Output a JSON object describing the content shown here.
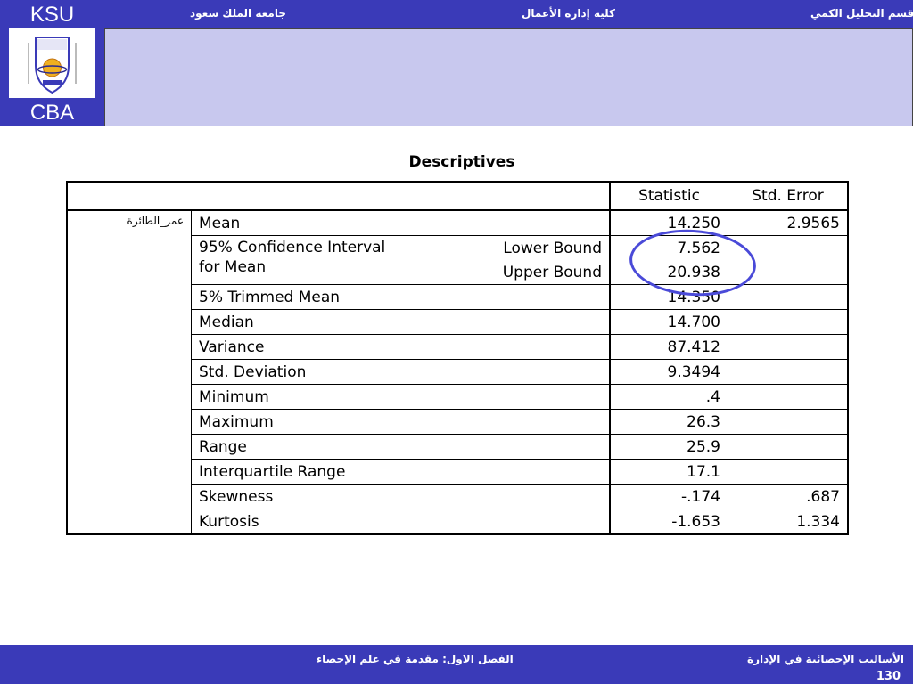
{
  "header": {
    "logo_top": "KSU",
    "logo_bottom": "CBA",
    "university": "جامعة الملك سعود",
    "college": "كلية إدارة الأعمال",
    "department": "قسم التحليل الكمي"
  },
  "table": {
    "title": "Descriptives",
    "col_statistic": "Statistic",
    "col_std_error": "Std. Error",
    "variable": "عمر_الطائرة",
    "rows": {
      "mean": {
        "label": "Mean",
        "stat": "14.250",
        "err": "2.9565"
      },
      "ci_label_1": "95% Confidence Interval",
      "ci_label_2": "for Mean",
      "ci_lower": {
        "label": "Lower Bound",
        "stat": "7.562"
      },
      "ci_upper": {
        "label": "Upper Bound",
        "stat": "20.938"
      },
      "trimmed": {
        "label": "5% Trimmed Mean",
        "stat": "14.350"
      },
      "median": {
        "label": "Median",
        "stat": "14.700"
      },
      "variance": {
        "label": "Variance",
        "stat": "87.412"
      },
      "std_dev": {
        "label": "Std. Deviation",
        "stat": "9.3494"
      },
      "minimum": {
        "label": "Minimum",
        "stat": ".4"
      },
      "maximum": {
        "label": "Maximum",
        "stat": "26.3"
      },
      "range": {
        "label": "Range",
        "stat": "25.9"
      },
      "iqr": {
        "label": "Interquartile Range",
        "stat": "17.1"
      },
      "skewness": {
        "label": "Skewness",
        "stat": "-.174",
        "err": ".687"
      },
      "kurtosis": {
        "label": "Kurtosis",
        "stat": "-1.653",
        "err": "1.334"
      }
    }
  },
  "footer": {
    "course": "الأساليب الإحصائية في الإدارة",
    "chapter": "الفصل الاول: مقدمة في علم الإحصاء",
    "page": "130"
  },
  "colors": {
    "brand_blue": "#3a3ab8",
    "panel": "#c8c8ee",
    "circle": "#4a4ad8"
  }
}
